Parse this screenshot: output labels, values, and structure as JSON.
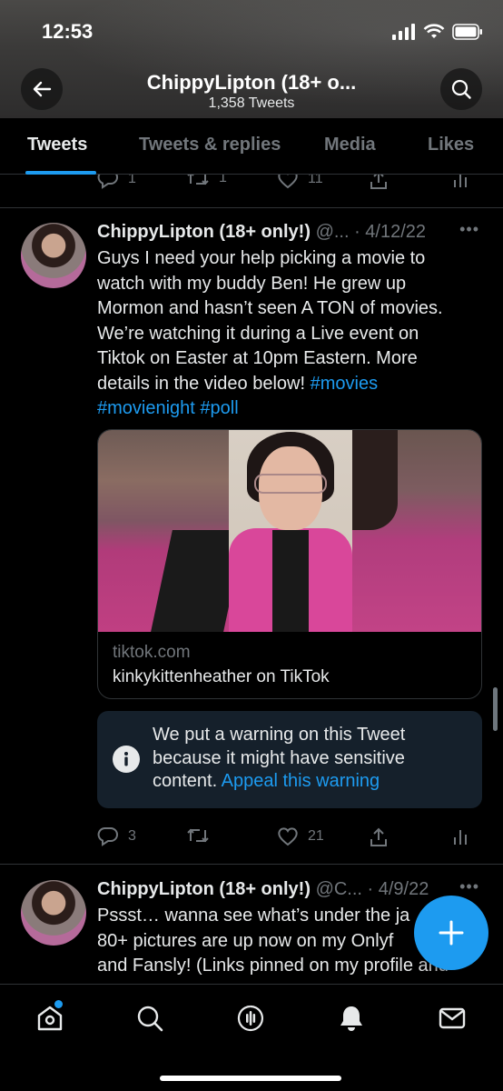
{
  "status_bar": {
    "time": "12:53"
  },
  "header": {
    "title": "ChippyLipton (18+ o...",
    "tweet_count": "1,358 Tweets",
    "back_icon": "arrow-left-icon",
    "search_icon": "search-icon"
  },
  "tabs": [
    {
      "label": "Tweets",
      "active": true
    },
    {
      "label": "Tweets & replies",
      "active": false
    },
    {
      "label": "Media",
      "active": false
    },
    {
      "label": "Likes",
      "active": false
    }
  ],
  "previous_tweet_actions": {
    "replies": "1",
    "retweets": "1",
    "likes": "11"
  },
  "tweets": [
    {
      "display_name": "ChippyLipton (18+ only!)",
      "meta": "@... · 4/12/22",
      "text_lines": [
        "Guys I need your help picking a movie to",
        "watch with my buddy Ben! He grew up",
        "Mormon and hasn’t seen A TON of movies.",
        "We’re watching it during a Live event on",
        "Tiktok on Easter at 10pm Eastern. More",
        "details in the video below!"
      ],
      "hashtags": [
        "#movies",
        "#movienight",
        "#poll"
      ],
      "card": {
        "domain": "tiktok.com",
        "title": "kinkykittenheather on TikTok"
      },
      "warning": {
        "text": "We put a warning on this Tweet because it might have sensitive content.",
        "link": "Appeal this warning"
      },
      "actions": {
        "replies": "3",
        "retweets": "",
        "likes": "21"
      }
    },
    {
      "display_name": "ChippyLipton (18+ only!)",
      "meta": "@C... · 4/9/22",
      "text_lines": [
        "Pssst… wanna see what’s under the ja",
        "80+ pictures are up now on my Onlyf",
        "and Fansly! (Links pinned on my profile and"
      ]
    }
  ],
  "colors": {
    "accent": "#1d9bf0",
    "background": "#000000",
    "muted": "#71767b"
  }
}
